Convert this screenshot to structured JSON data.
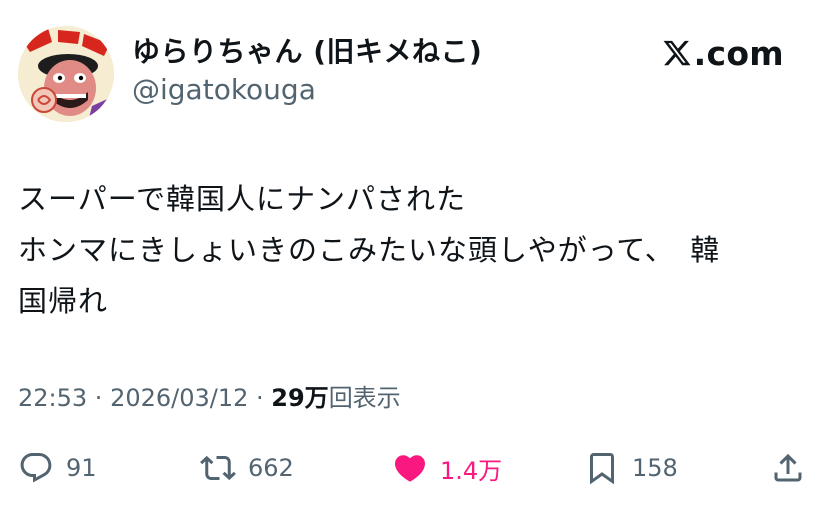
{
  "author": {
    "display_name": "ゆらりちゃん (旧キメねこ)",
    "handle": "@igatokouga",
    "avatar_icon": "avatar-image"
  },
  "brand": {
    "domain": ".com",
    "logo_icon": "x-logo-icon"
  },
  "tweet": {
    "lines": [
      "スーパーで韓国人にナンパされた",
      "ホンマにきしょいきのこみたいな頭しやがって、　韓",
      "国帰れ"
    ]
  },
  "meta": {
    "time": "22:53",
    "sep1": " · ",
    "date": "2026/03/12",
    "sep2": " · ",
    "views_count": "29万",
    "views_label": "回表示"
  },
  "actions": {
    "reply": {
      "icon": "reply-icon",
      "count": "91"
    },
    "repost": {
      "icon": "repost-icon",
      "count": "662"
    },
    "like": {
      "icon": "heart-icon",
      "count": "1.4万",
      "color": "#f91880"
    },
    "bookmark": {
      "icon": "bookmark-icon",
      "count": "158"
    },
    "share": {
      "icon": "share-icon"
    }
  },
  "colors": {
    "text": "#0f1419",
    "secondary": "#536471",
    "like": "#f91880"
  }
}
